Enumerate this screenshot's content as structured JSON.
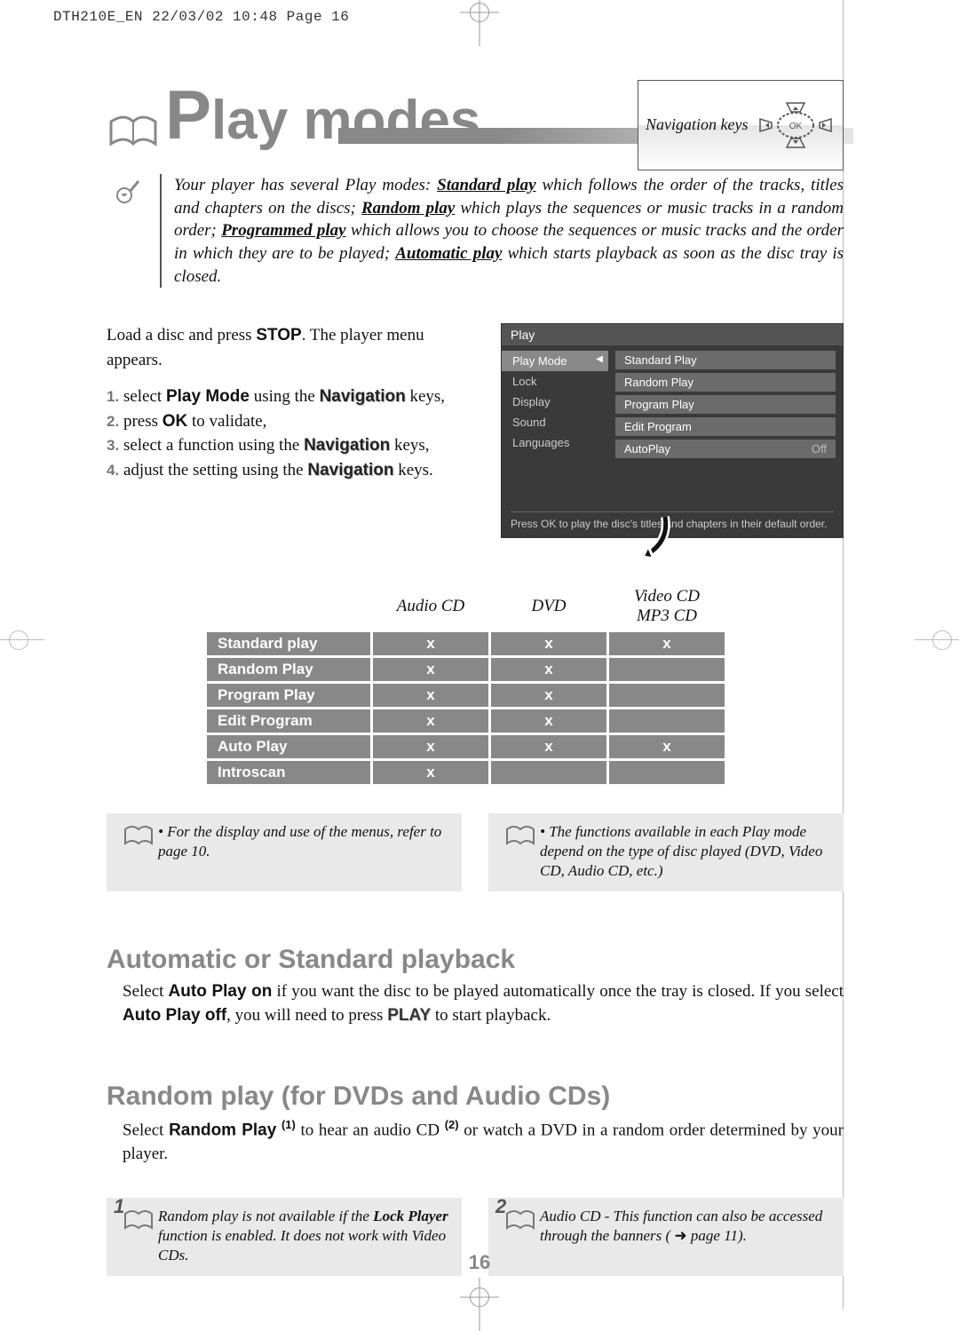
{
  "meta_line": "DTH210E_EN  22/03/02 10:48  Page 16",
  "title": "Play modes",
  "nav_label": "Navigation keys",
  "intro": {
    "pre": "Your player has several Play modes: ",
    "m1": "Standard play",
    "t1": " which follows the order of the tracks, titles and chapters on the discs; ",
    "m2": "Random play",
    "t2": " which plays the sequences or music tracks in a random order; ",
    "m3": "Programmed play",
    "t3": " which allows you to choose the sequences or music tracks and the order in which they are to be played; ",
    "m4": "Automatic play",
    "t4": " which starts playback as soon as the disc tray is closed."
  },
  "instructions": {
    "lead1": "Load a disc and press ",
    "stop": "STOP",
    "lead2": ". The player menu appears.",
    "s1a": "select ",
    "s1b": "Play Mode",
    "s1c": " using the ",
    "s1d": "Navigation",
    "s1e": " keys,",
    "s2a": "press ",
    "s2b": "OK",
    "s2c": " to validate,",
    "s3a": "select a function using the ",
    "s3b": "Navigation",
    "s3c": " keys,",
    "s4a": "adjust the setting using the ",
    "s4b": "Navigation",
    "s4c": " keys.",
    "n1": "1.",
    "n2": "2.",
    "n3": "3.",
    "n4": "4."
  },
  "screenshot": {
    "header": "Play",
    "left_items": [
      "Play Mode",
      "Lock",
      "Display",
      "Sound",
      "Languages"
    ],
    "selected_index": 0,
    "right_items": [
      {
        "label": "Standard Play",
        "extra": ""
      },
      {
        "label": "Random Play",
        "extra": ""
      },
      {
        "label": "Program Play",
        "extra": ""
      },
      {
        "label": "Edit Program",
        "extra": ""
      },
      {
        "label": "AutoPlay",
        "extra": "Off"
      }
    ],
    "hint": "Press OK to play the disc's titles and chapters in their default order."
  },
  "table": {
    "headers": [
      "Audio CD",
      "DVD",
      "Video CD MP3 CD"
    ],
    "rows": [
      {
        "name": "Standard play",
        "cells": [
          "x",
          "x",
          "x"
        ]
      },
      {
        "name": "Random Play",
        "cells": [
          "x",
          "x",
          ""
        ]
      },
      {
        "name": "Program Play",
        "cells": [
          "x",
          "x",
          ""
        ]
      },
      {
        "name": "Edit Program",
        "cells": [
          "x",
          "x",
          ""
        ]
      },
      {
        "name": "Auto Play",
        "cells": [
          "x",
          "x",
          "x"
        ]
      },
      {
        "name": "Introscan",
        "cells": [
          "x",
          "",
          ""
        ]
      }
    ]
  },
  "tip1": "• For the display and use of the menus, refer to page 10.",
  "tip2": "• The functions available in each Play mode depend on the type of disc played (DVD, Video CD, Audio CD, etc.)",
  "sec1_heading": "Automatic or Standard playback",
  "sec1": {
    "a": "Select ",
    "b": "Auto Play on",
    "c": " if you want the disc to be played automatically once the tray is closed. If you select ",
    "d": "Auto Play off",
    "e": ", you will need to press ",
    "f": "PLAY",
    "g": " to start playback."
  },
  "sec2_heading": "Random play (for DVDs and Audio CDs)",
  "sec2": {
    "a": "Select ",
    "b": "Random Play",
    "sup1": "(1)",
    "c": " to hear an audio CD ",
    "sup2": "(2)",
    "d": " or watch a DVD  in a random order determined by your player."
  },
  "ftip1": {
    "badge": "1",
    "a": "Random play is not available if the ",
    "b": "Lock Player",
    "c": " function is enabled. It does not work with Video CDs."
  },
  "ftip2": {
    "badge": "2",
    "a": "Audio CD  -  This function can also be accessed through the banners ( ",
    "arrow": "➜",
    "b": " page 11)."
  },
  "page_num": "16"
}
